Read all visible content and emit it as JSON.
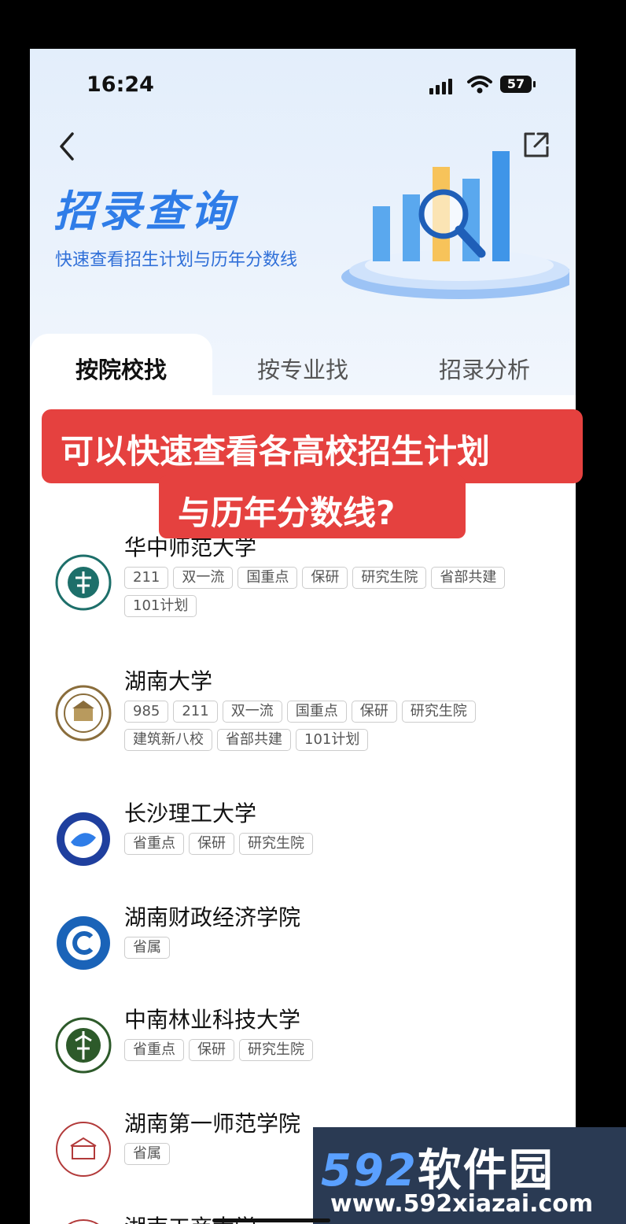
{
  "status_bar": {
    "time": "16:24",
    "battery": "57"
  },
  "header": {
    "title": "招录查询",
    "subtitle": "快速查看招生计划与历年分数线"
  },
  "tabs": [
    {
      "label": "按院校找",
      "active": true
    },
    {
      "label": "按专业找",
      "active": false
    },
    {
      "label": "招录分析",
      "active": false
    }
  ],
  "overlay": {
    "line1": "可以快速查看各高校招生计划",
    "line2": "与历年分数线?"
  },
  "schools": [
    {
      "name": "华中师范大学",
      "tags": [
        "211",
        "双一流",
        "国重点",
        "保研",
        "研究生院",
        "省部共建",
        "101计划"
      ]
    },
    {
      "name": "湖南大学",
      "tags": [
        "985",
        "211",
        "双一流",
        "国重点",
        "保研",
        "研究生院",
        "建筑新八校",
        "省部共建",
        "101计划"
      ]
    },
    {
      "name": "长沙理工大学",
      "tags": [
        "省重点",
        "保研",
        "研究生院"
      ]
    },
    {
      "name": "湖南财政经济学院",
      "tags": [
        "省属"
      ]
    },
    {
      "name": "中南林业科技大学",
      "tags": [
        "省重点",
        "保研",
        "研究生院"
      ]
    },
    {
      "name": "湖南第一师范学院",
      "tags": [
        "省属"
      ]
    },
    {
      "name": "湖南工商大学",
      "tags": []
    }
  ],
  "watermark": {
    "brand_number": "592",
    "brand_text": "软件园",
    "url": "www.592xiazai.com"
  },
  "colors": {
    "accent": "#2f7de8",
    "overlay_red": "#e5413f"
  },
  "icons": [
    "back-arrow-icon",
    "share-icon",
    "signal-icon",
    "wifi-icon",
    "battery-icon"
  ]
}
